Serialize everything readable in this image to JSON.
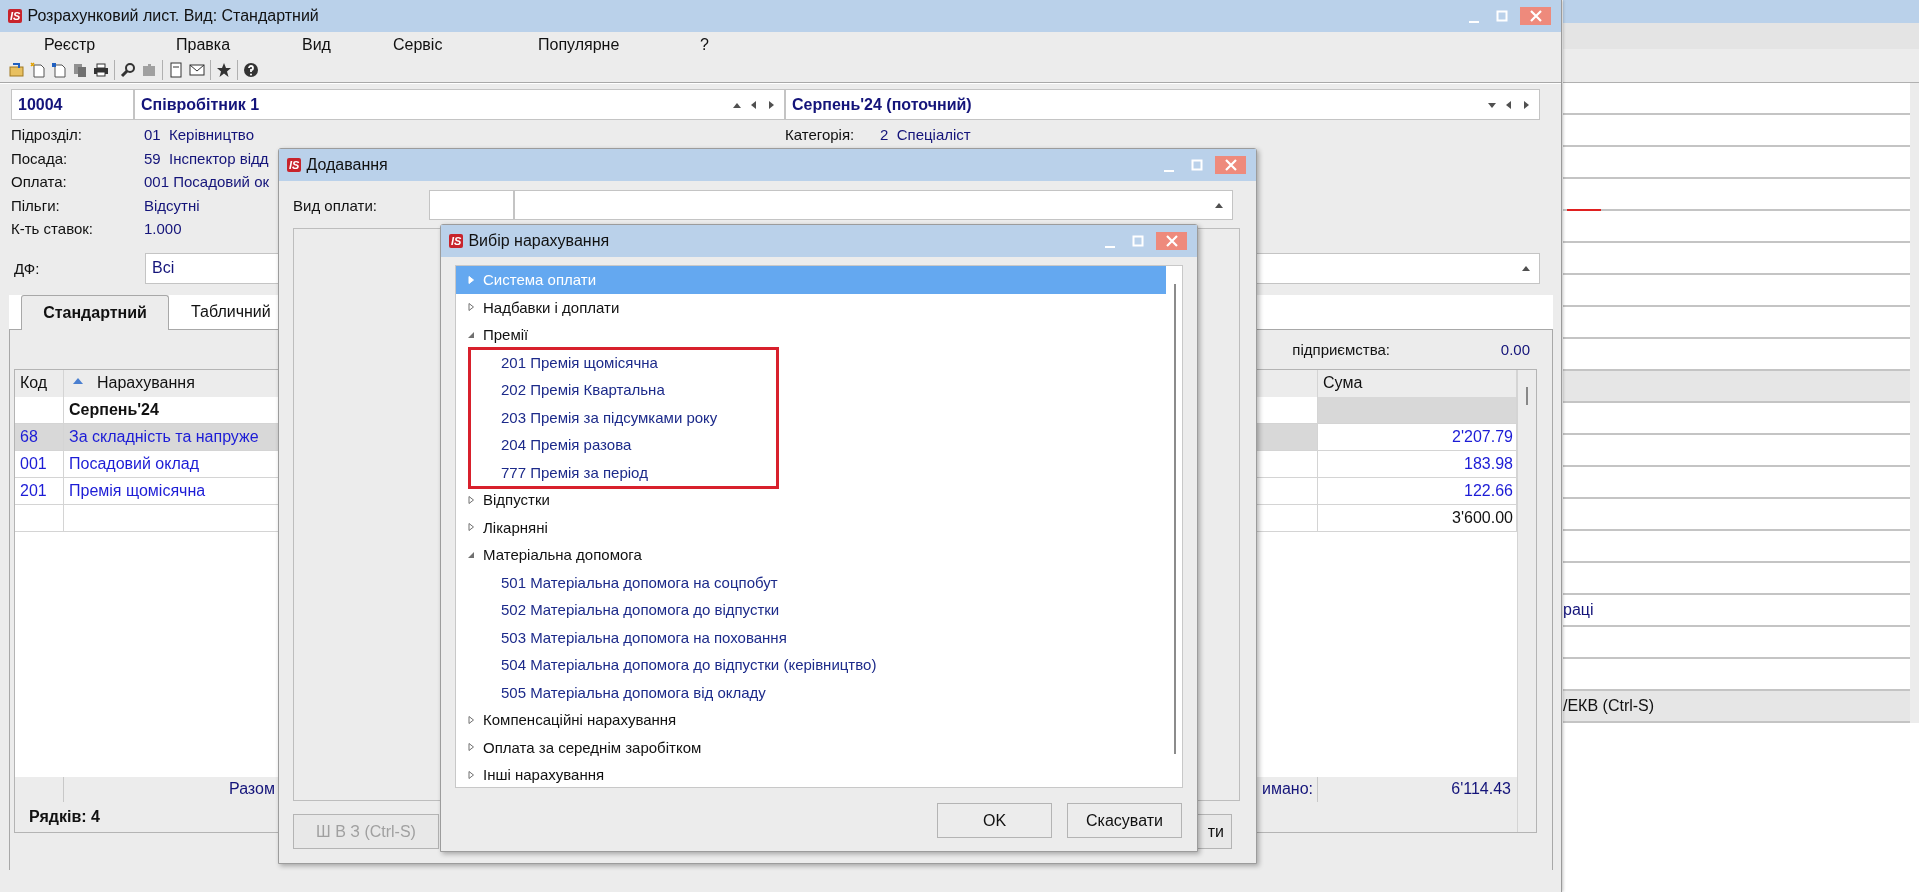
{
  "main_window": {
    "logo": "IS",
    "title": "Розрахунковий лист. Вид: Стандартний",
    "menu": [
      "Реєстр",
      "Правка",
      "Вид",
      "Сервіс",
      "Популярне",
      "?"
    ],
    "employee_code": "10004",
    "employee_name": "Співробітник 1",
    "period": "Серпень'24 (поточний)",
    "details": [
      {
        "label": "Підрозділ:",
        "value": "01  Керівництво"
      },
      {
        "label": "Посада:",
        "value": "59  Інспектор відд"
      },
      {
        "label": "Оплата:",
        "value": "001 Посадовий ок"
      },
      {
        "label": "Пільги:",
        "value": "Відсутні"
      },
      {
        "label": "К-ть ставок:",
        "value": "1.000"
      }
    ],
    "category": {
      "label": "Категорія:",
      "value": "2  Спеціаліст"
    },
    "df": {
      "label": "ДФ:",
      "value": "Всі"
    },
    "tabs": [
      {
        "label": "Стандартний",
        "selected": true
      },
      {
        "label": "Табличний",
        "selected": false
      }
    ],
    "enterprise": {
      "label": "підприємства:",
      "value": "0.00"
    },
    "table": {
      "columns": [
        "Код",
        "Нарахування",
        "Сума"
      ],
      "rows": [
        {
          "kind": "group",
          "title": "Серпень'24"
        },
        {
          "kind": "item",
          "code": "68",
          "name": "За складність та напруже",
          "sum": "2'207.79",
          "selected": true
        },
        {
          "kind": "item",
          "code": "001",
          "name": "Посадовий оклад",
          "sum": "183.98",
          "selected": false
        },
        {
          "kind": "item",
          "code": "201",
          "name": "Премія щомісячна",
          "sum": "122.66",
          "selected": false
        },
        {
          "kind": "total",
          "sum": "3'600.00"
        }
      ],
      "footer": {
        "left": "Разом",
        "right": "имано:",
        "sum": "6'114.43"
      }
    },
    "row_count": "Рядків: 4"
  },
  "add_dialog": {
    "logo": "IS",
    "title": "Додавання",
    "field_label": "Вид оплати:",
    "buttons": [
      {
        "label": "Ш В З (Ctrl-S)",
        "disabled": true
      },
      {
        "label": "ти",
        "disabled": false
      }
    ]
  },
  "choice_dialog": {
    "logo": "IS",
    "title": "Вибір нарахування",
    "tree": [
      {
        "label": "Система оплати",
        "expanded": false,
        "selected": true
      },
      {
        "label": "Надбавки і доплати",
        "expanded": false,
        "selected": false
      },
      {
        "label": "Премії",
        "expanded": true,
        "selected": false,
        "highlighted": true,
        "children": [
          {
            "label": "201 Премія щомісячна",
            "selected": false
          },
          {
            "label": "202 Премія Квартальна",
            "selected": false
          },
          {
            "label": "203 Премія за підсумками року",
            "selected": false
          },
          {
            "label": "204 Премія разова",
            "selected": false
          },
          {
            "label": "777 Премія за період",
            "selected": false
          }
        ]
      },
      {
        "label": "Відпустки",
        "expanded": false,
        "selected": false
      },
      {
        "label": "Лікарняні",
        "expanded": false,
        "selected": false
      },
      {
        "label": "Матеріальна допомога",
        "expanded": true,
        "selected": false,
        "children": [
          {
            "label": "501 Матеріальна допомога на соцпобут",
            "selected": false
          },
          {
            "label": "502 Матеріальна допомога до відпустки",
            "selected": false
          },
          {
            "label": "503 Матеріальна допомога на поховання",
            "selected": false
          },
          {
            "label": "504 Матеріальна допомога до відпустки (керівництво)",
            "selected": false
          },
          {
            "label": "505 Матеріальна допомога від окладу",
            "selected": false
          }
        ]
      },
      {
        "label": "Компенсаційні нарахування",
        "expanded": false,
        "selected": false
      },
      {
        "label": "Оплата за середнім заробітком",
        "expanded": false,
        "selected": false
      },
      {
        "label": "Інші нарахування",
        "expanded": false,
        "selected": false
      }
    ],
    "buttons": [
      "OK",
      "Скасувати"
    ]
  },
  "background_window": {
    "rows": [
      {
        "kind": "field"
      },
      {
        "kind": "field"
      },
      {
        "kind": "field"
      },
      {
        "kind": "marked"
      },
      {
        "kind": "field"
      },
      {
        "kind": "field"
      },
      {
        "kind": "field"
      },
      {
        "kind": "field"
      },
      {
        "kind": "field"
      },
      {
        "kind": "bar"
      },
      {
        "kind": "field"
      },
      {
        "kind": "field"
      },
      {
        "kind": "field"
      },
      {
        "kind": "field"
      },
      {
        "kind": "field"
      },
      {
        "kind": "field"
      },
      {
        "kind": "field",
        "text": "раці"
      },
      {
        "kind": "field"
      },
      {
        "kind": "field"
      },
      {
        "kind": "bar",
        "text": "/ЕКВ (Ctrl-S)"
      }
    ]
  }
}
